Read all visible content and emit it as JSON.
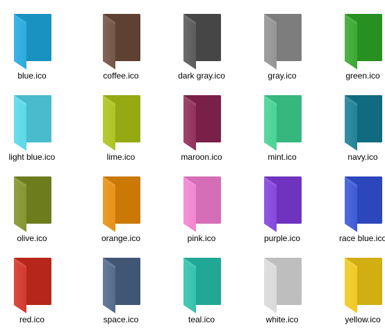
{
  "files": [
    {
      "label": "blue.ico",
      "icon": "folder-icon",
      "color": "#1CA6DC"
    },
    {
      "label": "coffee.ico",
      "icon": "folder-icon",
      "color": "#6B4A3A"
    },
    {
      "label": "dark gray.ico",
      "icon": "folder-icon",
      "color": "#505050"
    },
    {
      "label": "gray.ico",
      "icon": "folder-icon",
      "color": "#8E8E8E"
    },
    {
      "label": "green.ico",
      "icon": "folder-icon",
      "color": "#2EA424"
    },
    {
      "label": "light blue.ico",
      "icon": "folder-icon",
      "color": "#52D6E8"
    },
    {
      "label": "lime.ico",
      "icon": "folder-icon",
      "color": "#A9C014"
    },
    {
      "label": "maroon.ico",
      "icon": "folder-icon",
      "color": "#8A2452"
    },
    {
      "label": "mint.ico",
      "icon": "folder-icon",
      "color": "#3DD08E"
    },
    {
      "label": "navy.ico",
      "icon": "folder-icon",
      "color": "#137A92"
    },
    {
      "label": "olive.ico",
      "icon": "folder-icon",
      "color": "#7C8E22"
    },
    {
      "label": "orange.ico",
      "icon": "folder-icon",
      "color": "#E58A08"
    },
    {
      "label": "pink.ico",
      "icon": "folder-icon",
      "color": "#F27DCF"
    },
    {
      "label": "purple.ico",
      "icon": "folder-icon",
      "color": "#7E3ADA"
    },
    {
      "label": "race blue.ico",
      "icon": "folder-icon",
      "color": "#324FD6"
    },
    {
      "label": "red.ico",
      "icon": "folder-icon",
      "color": "#CF2B1E"
    },
    {
      "label": "space.ico",
      "icon": "folder-icon",
      "color": "#4A6285"
    },
    {
      "label": "teal.ico",
      "icon": "folder-icon",
      "color": "#26BFA8"
    },
    {
      "label": "white.ico",
      "icon": "folder-icon",
      "color": "#D8D8D8"
    },
    {
      "label": "yellow.ico",
      "icon": "folder-icon",
      "color": "#EEC615"
    }
  ]
}
